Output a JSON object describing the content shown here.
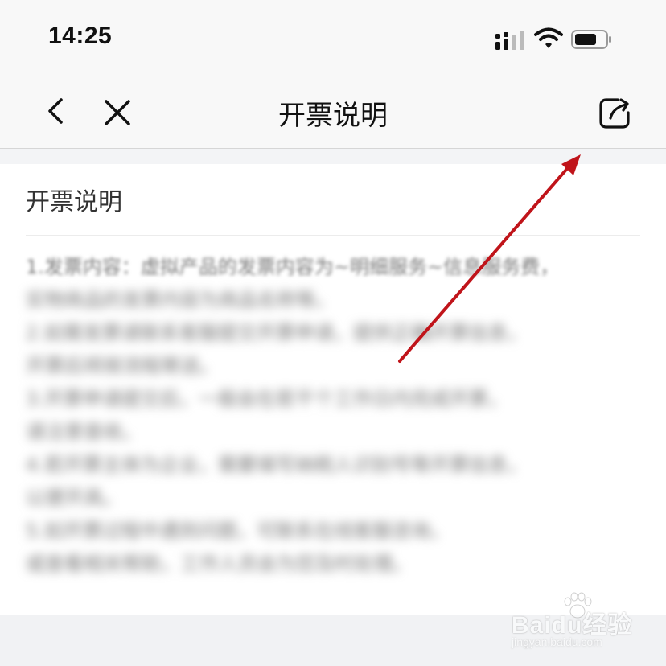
{
  "status_bar": {
    "time": "14:25",
    "icons": [
      "signal-icon",
      "wifi-icon",
      "battery-icon"
    ]
  },
  "nav": {
    "title": "开票说明",
    "icons": [
      "back-icon",
      "close-icon",
      "share-icon"
    ]
  },
  "content": {
    "title": "开票说明",
    "lines": [
      "1.发票内容：虚拟产品的发票内容为~明细服务~信息服务费，",
      "实物商品的发票内容为商品名称等。",
      "2.如需发票请联系客服提交开票申请，提供正确开票信息，",
      "开票后将按流程寄送。",
      "3.开票申请提交后，一般会在若干个工作日内完成开票，",
      "请注意查收。",
      "4.若开票主体为企业，需要填写纳税人识别号等开票信息，",
      "以便开具。",
      "5.如开票过程中遇到问题，可联系在线客服咨询，",
      "或查看相关帮助，工作人员会为您及时处理。"
    ]
  },
  "watermark": {
    "brand": "Baidu经验",
    "url": "jingyan.baidu.com"
  },
  "colors": {
    "arrow": "#c0141a",
    "nav_background": "#f8f8f8",
    "body_text": "#777777"
  }
}
